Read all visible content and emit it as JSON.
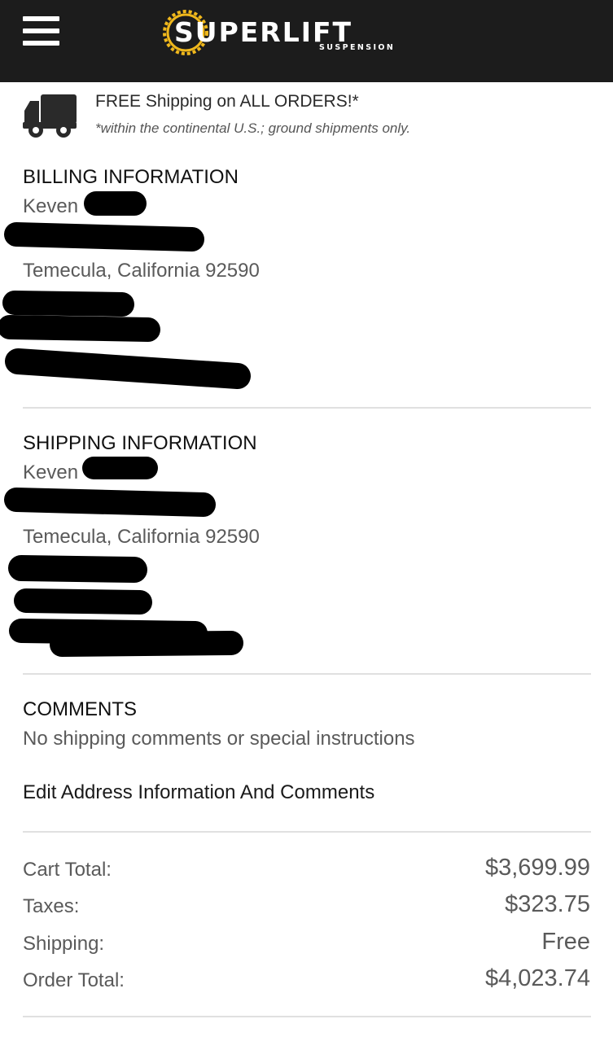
{
  "header": {
    "menu_icon": "hamburger-menu-icon",
    "logo_text": "SUPERLIFT",
    "logo_subtext": "SUSPENSION",
    "logo_accent": "#f0b81c"
  },
  "shipping_banner": {
    "icon": "truck-icon",
    "title": "FREE Shipping on ALL ORDERS!*",
    "note": "*within the continental U.S.; ground shipments only."
  },
  "billing": {
    "title": "BILLING INFORMATION",
    "name": "Keven",
    "city_line": "Temecula, California 92590"
  },
  "shipping": {
    "title": "SHIPPING INFORMATION",
    "name": "Keven",
    "city_line": "Temecula, California 92590"
  },
  "comments": {
    "title": "COMMENTS",
    "text": "No shipping comments or special instructions"
  },
  "edit_link": "Edit Address Information And Comments",
  "totals": {
    "cart_total_label": "Cart Total:",
    "cart_total_value": "$3,699.99",
    "taxes_label": "Taxes:",
    "taxes_value": "$323.75",
    "shipping_label": "Shipping:",
    "shipping_value": "Free",
    "order_total_label": "Order Total:",
    "order_total_value": "$4,023.74"
  }
}
